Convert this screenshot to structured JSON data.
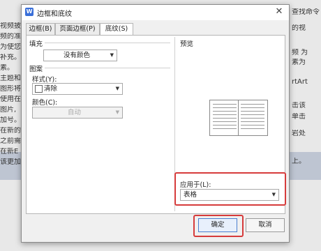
{
  "background": {
    "left_lines": [
      "视频披",
      "频的准",
      "为使您",
      "补充。",
      "素。",
      "主题和",
      "图形将",
      "使用在",
      "图片,",
      "加号。",
      "在新的",
      "之前需",
      "在新E",
      "该更加"
    ],
    "right_lines": [
      "查找命令",
      "的视",
      "频 为",
      "素为",
      "rtArt",
      "击该",
      "单击",
      "岩处",
      "上。"
    ]
  },
  "dialog": {
    "title": "边框和底纹",
    "close_glyph": "✕"
  },
  "tabs": [
    {
      "label": "边框(B)",
      "active": false
    },
    {
      "label": "页面边框(P)",
      "active": false
    },
    {
      "label": "底纹(S)",
      "active": true
    }
  ],
  "fill": {
    "section_label": "填充",
    "color_value": "没有颜色"
  },
  "pattern": {
    "section_label": "图案",
    "style_label": "样式(Y):",
    "style_value": "清除",
    "color_label": "颜色(C):",
    "color_value": "自动"
  },
  "preview": {
    "label": "预览"
  },
  "apply_to": {
    "label": "应用于(L):",
    "value": "表格"
  },
  "buttons": {
    "ok": "确定",
    "cancel": "取消"
  },
  "colors": {
    "highlight": "#d63b3b",
    "accent": "#3a6fd8"
  }
}
